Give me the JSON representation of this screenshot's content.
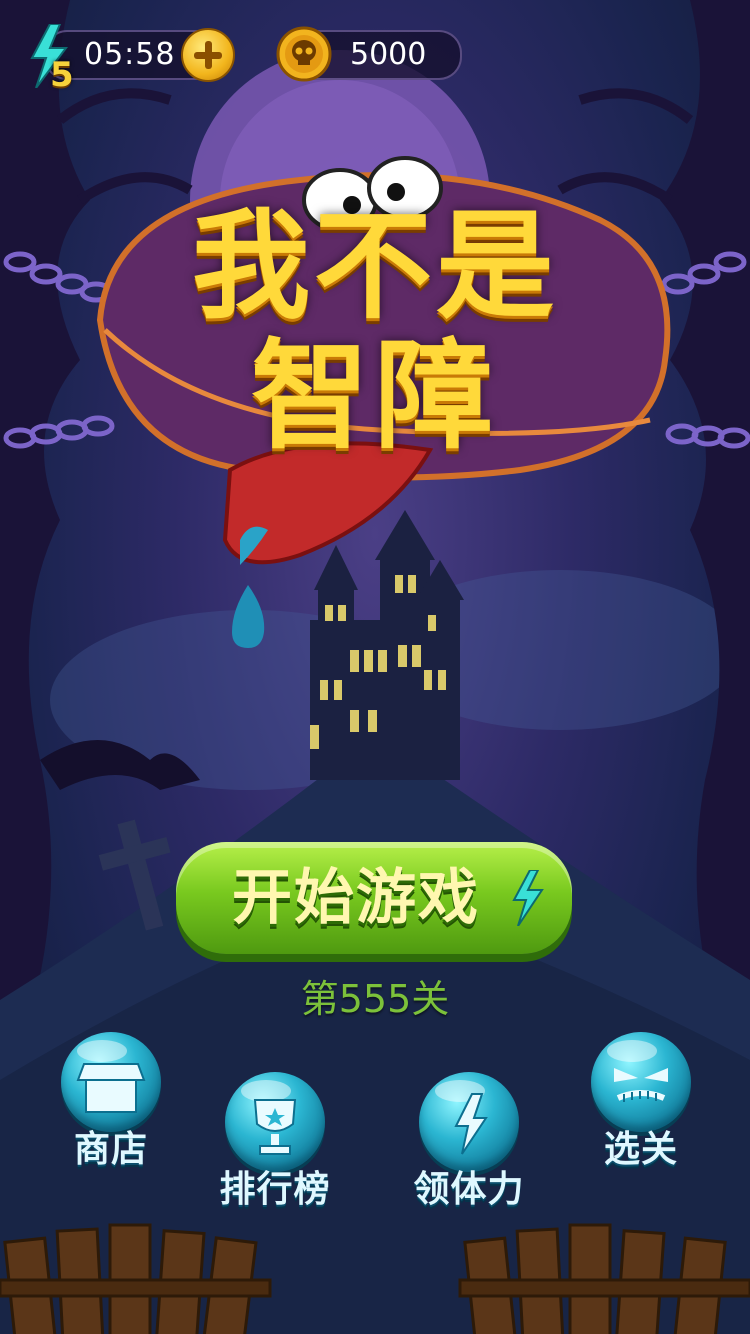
{
  "hud": {
    "energy_count": "5",
    "energy_timer": "05:58",
    "coins": "5000"
  },
  "title": {
    "line1": "我不是",
    "line2": "智障"
  },
  "start": {
    "label": "开始游戏",
    "level": "第555关"
  },
  "menu": {
    "shop": "商店",
    "leaderboard": "排行榜",
    "claim_energy": "领体力",
    "level_select": "选关"
  },
  "icons": [
    "lightning-icon",
    "plus-icon",
    "skull-coin-icon",
    "shop-icon",
    "trophy-icon",
    "lightning-icon",
    "angry-face-icon"
  ]
}
